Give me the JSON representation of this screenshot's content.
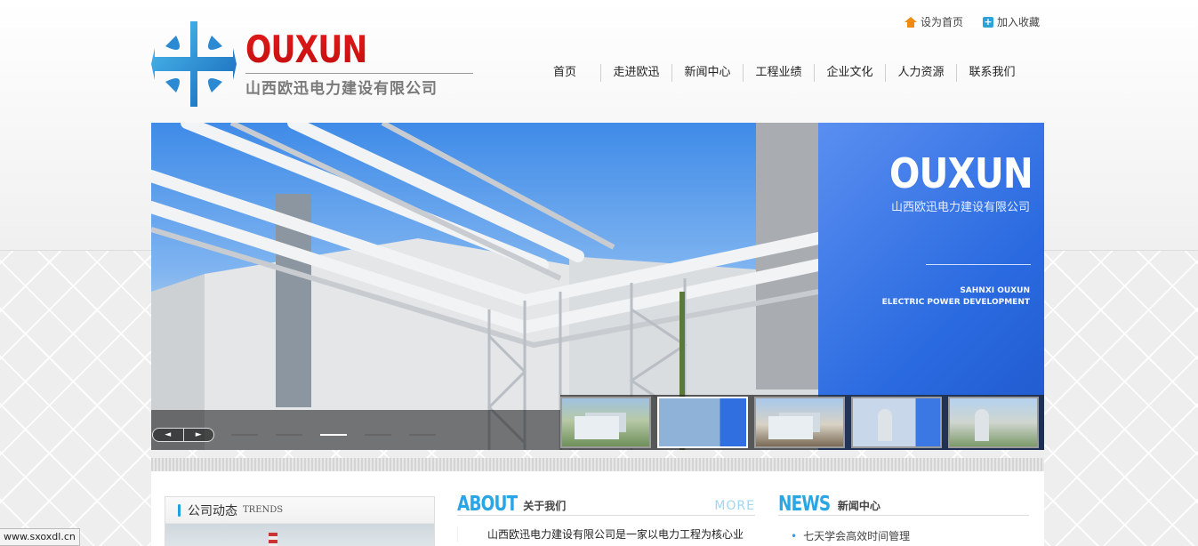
{
  "header": {
    "logo_word": "OUXUN",
    "logo_cn": "山西欧迅电力建设有限公司",
    "top_links": [
      "设为首页",
      "加入收藏"
    ]
  },
  "nav": [
    "首页",
    "走进欧迅",
    "新闻中心",
    "工程业绩",
    "企业文化",
    "人力资源",
    "联系我们"
  ],
  "banner": {
    "brand_word": "OUXUN",
    "brand_cn": "山西欧迅电力建设有限公司",
    "brand_en_1": "SAHNXI OUXUN",
    "brand_en_2": "ELECTRIC POWER DEVELOPMENT",
    "prev_label": "◄",
    "next_label": "►",
    "dot_count": 5,
    "active_dot": 2,
    "active_thumb": 2
  },
  "trends": {
    "title": "公司动态",
    "en": "TRENDS"
  },
  "about": {
    "en": "ABOUT",
    "cn": "关于我们",
    "more": "MORE",
    "text": "山西欧迅电力建设有限公司是一家以电力工程为核心业"
  },
  "news": {
    "en": "NEWS",
    "cn": "新闻中心",
    "items": [
      "七天学会高效时间管理"
    ]
  },
  "status_url": "www.sxoxdl.cn",
  "colors": {
    "accent": "#29a6e3",
    "logo_red": "#d81818",
    "banner_blue": "#2a6ae0"
  }
}
